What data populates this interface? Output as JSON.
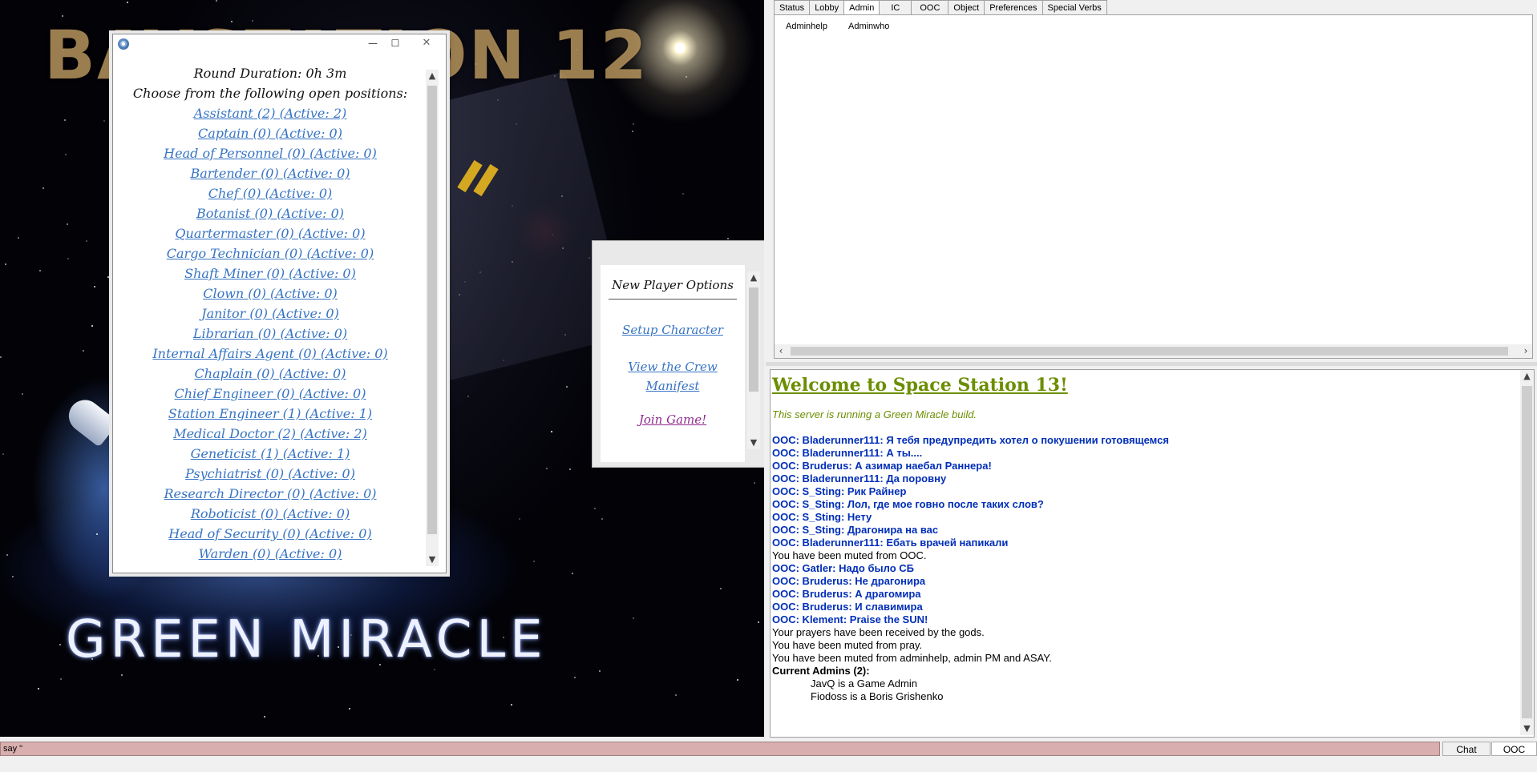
{
  "map": {
    "logo_top": "BAYSTATION 12",
    "logo_bottom": "GREEN MIRACLE"
  },
  "job_window": {
    "round_duration": "Round Duration: 0h 3m",
    "choose_text": "Choose from the following open positions:",
    "jobs": [
      "Assistant (2) (Active: 2)",
      "Captain (0) (Active: 0)",
      "Head of Personnel (0) (Active: 0)",
      "Bartender (0) (Active: 0)",
      "Chef (0) (Active: 0)",
      "Botanist (0) (Active: 0)",
      "Quartermaster (0) (Active: 0)",
      "Cargo Technician (0) (Active: 0)",
      "Shaft Miner (0) (Active: 0)",
      "Clown (0) (Active: 0)",
      "Janitor (0) (Active: 0)",
      "Librarian (0) (Active: 0)",
      "Internal Affairs Agent (0) (Active: 0)",
      "Chaplain (0) (Active: 0)",
      "Chief Engineer (0) (Active: 0)",
      "Station Engineer (1) (Active: 1)",
      "Medical Doctor (2) (Active: 2)",
      "Geneticist (1) (Active: 1)",
      "Psychiatrist (0) (Active: 0)",
      "Research Director (0) (Active: 0)",
      "Roboticist (0) (Active: 0)",
      "Head of Security (0) (Active: 0)",
      "Warden (0) (Active: 0)"
    ]
  },
  "new_player_options": {
    "title": "New Player Options",
    "setup_character": "Setup Character",
    "view_manifest_line1": "View the Crew",
    "view_manifest_line2": "Manifest",
    "join_game": "Join Game!"
  },
  "tabs": [
    "Status",
    "Lobby",
    "Admin",
    "IC",
    "OOC",
    "Object",
    "Preferences",
    "Special Verbs"
  ],
  "active_tab": "Admin",
  "verbs": {
    "adminhelp": "Adminhelp",
    "adminwho": "Adminwho"
  },
  "output": {
    "welcome": "Welcome to Space Station 13!",
    "motd": "This server is running a Green Miracle build.",
    "messages": [
      {
        "kind": "ooc",
        "text": "OOC: Bladerunner111: Я тебя предупредить хотел о покушении готовящемся"
      },
      {
        "kind": "ooc",
        "text": "OOC: Bladerunner111: А ты...."
      },
      {
        "kind": "ooc",
        "text": "OOC: Bruderus: А азимар наебал Раннера!"
      },
      {
        "kind": "ooc",
        "text": "OOC: Bladerunner111: Да поровну"
      },
      {
        "kind": "ooc",
        "text": "OOC: S_Sting: Рик Райнер"
      },
      {
        "kind": "ooc",
        "text": "OOC: S_Sting: Лол, где мое говно после таких слов?"
      },
      {
        "kind": "ooc",
        "text": "OOC: S_Sting: Нету"
      },
      {
        "kind": "ooc",
        "text": "OOC: S_Sting: Драгонира на вас"
      },
      {
        "kind": "ooc",
        "text": "OOC: Bladerunner111: Ебать врачей напикали"
      },
      {
        "kind": "sys",
        "text": "You have been muted from OOC."
      },
      {
        "kind": "ooc",
        "text": "OOC: Gatler: Надо было СБ"
      },
      {
        "kind": "ooc",
        "text": "OOC: Bruderus: Не драгонира"
      },
      {
        "kind": "ooc",
        "text": "OOC: Bruderus: А драгомира"
      },
      {
        "kind": "ooc",
        "text": "OOC: Bruderus: И славимира"
      },
      {
        "kind": "ooc",
        "text": "OOC: Klement: Praise the SUN!"
      },
      {
        "kind": "sys",
        "text": "Your prayers have been received by the gods."
      },
      {
        "kind": "sys",
        "text": "You have been muted from pray."
      },
      {
        "kind": "sys",
        "text": "You have been muted from adminhelp, admin PM and ASAY."
      },
      {
        "kind": "bold",
        "text": "Current Admins (2):"
      },
      {
        "kind": "indent",
        "text": "JavQ is a Game Admin"
      },
      {
        "kind": "indent",
        "text": "Fiodoss is a Boris Grishenko"
      }
    ]
  },
  "input": {
    "value": "say \""
  },
  "buttons": {
    "chat": "Chat",
    "ooc": "OOC"
  },
  "colors": {
    "link": "#3774c3",
    "join_link": "#8e2a8e",
    "welcome": "#6b8e00",
    "ooc": "#002eb8",
    "input_bg": "#d9aeae"
  }
}
